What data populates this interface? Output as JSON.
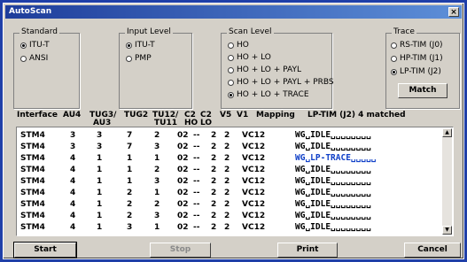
{
  "window": {
    "title": "AutoScan",
    "close_glyph": "×"
  },
  "standard": {
    "legend": "Standard",
    "options": [
      {
        "label": "ITU-T",
        "selected": true
      },
      {
        "label": "ANSI",
        "selected": false
      }
    ]
  },
  "input_level": {
    "legend": "Input Level",
    "options": [
      {
        "label": "ITU-T",
        "selected": true
      },
      {
        "label": "PMP",
        "selected": false
      }
    ]
  },
  "scan_level": {
    "legend": "Scan Level",
    "options": [
      {
        "label": "HO",
        "selected": false
      },
      {
        "label": "HO + LO",
        "selected": false
      },
      {
        "label": "HO + LO + PAYL",
        "selected": false
      },
      {
        "label": "HO + LO + PAYL + PRBS",
        "selected": false
      },
      {
        "label": "HO + LO + TRACE",
        "selected": true
      }
    ]
  },
  "trace": {
    "legend": "Trace",
    "options": [
      {
        "label": "RS-TIM (J0)",
        "selected": false
      },
      {
        "label": "HP-TIM (J1)",
        "selected": false
      },
      {
        "label": "LP-TIM (J2)",
        "selected": true
      }
    ],
    "match_label": "Match"
  },
  "table": {
    "headers": {
      "interface": "Interface",
      "au4": "AU4",
      "tug3_l1": "TUG3/",
      "tug3_l2": "AU3",
      "tug2": "TUG2",
      "tu12_l1": "TU12/",
      "tu12_l2": "TU11",
      "c2ho_l1": "C2",
      "c2ho_l2": "HO",
      "c2lo_l1": "C2",
      "c2lo_l2": "LO",
      "v5": "V5",
      "v1": "V1",
      "mapping": "Mapping",
      "status": "LP-TIM (J2) 4 matched"
    },
    "rows": [
      {
        "interface": "STM4",
        "au4": "3",
        "tug3": "3",
        "tug2": "7",
        "tu12": "2",
        "c2ho": "02",
        "c2lo": "--",
        "v5": "2",
        "v1": "2",
        "mapping": "VC12",
        "msg": "WG␣IDLE␣␣␣␣␣␣␣␣",
        "highlight": false
      },
      {
        "interface": "STM4",
        "au4": "3",
        "tug3": "3",
        "tug2": "7",
        "tu12": "3",
        "c2ho": "02",
        "c2lo": "--",
        "v5": "2",
        "v1": "2",
        "mapping": "VC12",
        "msg": "WG␣IDLE␣␣␣␣␣␣␣␣",
        "highlight": false
      },
      {
        "interface": "STM4",
        "au4": "4",
        "tug3": "1",
        "tug2": "1",
        "tu12": "1",
        "c2ho": "02",
        "c2lo": "--",
        "v5": "2",
        "v1": "2",
        "mapping": "VC12",
        "msg": "WG␣LP-TRACE␣␣␣␣␣",
        "highlight": true
      },
      {
        "interface": "STM4",
        "au4": "4",
        "tug3": "1",
        "tug2": "1",
        "tu12": "2",
        "c2ho": "02",
        "c2lo": "--",
        "v5": "2",
        "v1": "2",
        "mapping": "VC12",
        "msg": "WG␣IDLE␣␣␣␣␣␣␣␣",
        "highlight": false
      },
      {
        "interface": "STM4",
        "au4": "4",
        "tug3": "1",
        "tug2": "1",
        "tu12": "3",
        "c2ho": "02",
        "c2lo": "--",
        "v5": "2",
        "v1": "2",
        "mapping": "VC12",
        "msg": "WG␣IDLE␣␣␣␣␣␣␣␣",
        "highlight": false
      },
      {
        "interface": "STM4",
        "au4": "4",
        "tug3": "1",
        "tug2": "2",
        "tu12": "1",
        "c2ho": "02",
        "c2lo": "--",
        "v5": "2",
        "v1": "2",
        "mapping": "VC12",
        "msg": "WG␣IDLE␣␣␣␣␣␣␣␣",
        "highlight": false
      },
      {
        "interface": "STM4",
        "au4": "4",
        "tug3": "1",
        "tug2": "2",
        "tu12": "2",
        "c2ho": "02",
        "c2lo": "--",
        "v5": "2",
        "v1": "2",
        "mapping": "VC12",
        "msg": "WG␣IDLE␣␣␣␣␣␣␣␣",
        "highlight": false
      },
      {
        "interface": "STM4",
        "au4": "4",
        "tug3": "1",
        "tug2": "2",
        "tu12": "3",
        "c2ho": "02",
        "c2lo": "--",
        "v5": "2",
        "v1": "2",
        "mapping": "VC12",
        "msg": "WG␣IDLE␣␣␣␣␣␣␣␣",
        "highlight": false
      },
      {
        "interface": "STM4",
        "au4": "4",
        "tug3": "1",
        "tug2": "3",
        "tu12": "1",
        "c2ho": "02",
        "c2lo": "--",
        "v5": "2",
        "v1": "2",
        "mapping": "VC12",
        "msg": "WG␣IDLE␣␣␣␣␣␣␣␣",
        "highlight": false
      }
    ]
  },
  "buttons": {
    "start": "Start",
    "stop": "Stop",
    "print": "Print",
    "cancel": "Cancel"
  },
  "colors": {
    "highlight_text": "#1040C8",
    "title_bar": "#1E3D9B",
    "window_bg": "#D4D0C8"
  },
  "icons": {
    "scroll_up": "▲",
    "scroll_down": "▼"
  }
}
